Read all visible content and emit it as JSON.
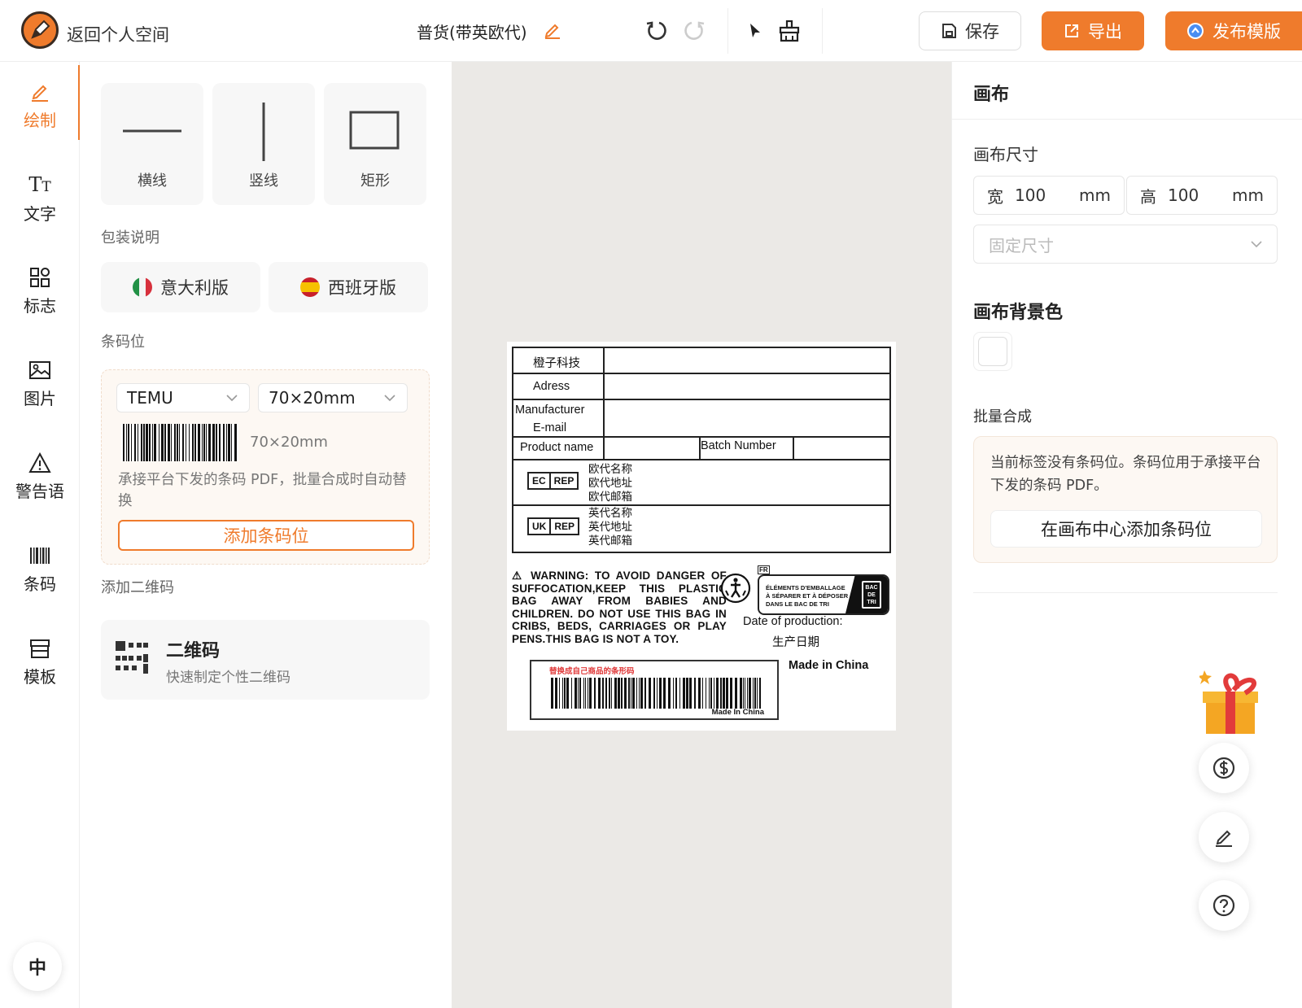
{
  "header": {
    "back_label": "返回个人空间",
    "doc_title": "普货(带英欧代)",
    "buttons": {
      "save": "保存",
      "export": "导出",
      "publish": "发布模版"
    }
  },
  "leftnav": {
    "items": [
      {
        "label": "绘制",
        "icon": "pencil-icon",
        "active": true
      },
      {
        "label": "文字",
        "icon": "text-icon"
      },
      {
        "label": "标志",
        "icon": "grid-icon"
      },
      {
        "label": "图片",
        "icon": "image-icon"
      },
      {
        "label": "警告语",
        "icon": "warning-icon"
      },
      {
        "label": "条码",
        "icon": "barcode-icon"
      },
      {
        "label": "模板",
        "icon": "store-icon"
      }
    ],
    "lang": "中"
  },
  "tools": {
    "shapes": [
      "横线",
      "竖线",
      "矩形"
    ],
    "packaging_label": "包装说明",
    "packaging": [
      "意大利版",
      "西班牙版"
    ],
    "barcode_label": "条码位",
    "barcode_platform": "TEMU",
    "barcode_size": "70×20mm",
    "barcode_preview_size": "70×20mm",
    "barcode_desc": "承接平台下发的条码 PDF，批量合成时自动替换",
    "barcode_add": "添加条码位",
    "qr_label": "添加二维码",
    "qr_title": "二维码",
    "qr_sub": "快速制定个性二维码"
  },
  "label": {
    "company": "橙子科技",
    "address": "Adress",
    "manufacturer": "Manufacturer",
    "email": "E-mail",
    "product_name": "Product  name",
    "batch_number": "Batch  Number",
    "ec_rep": [
      "EC",
      "REP"
    ],
    "eu_lines": [
      "欧代名称",
      "欧代地址",
      "欧代邮箱"
    ],
    "uk_rep": [
      "UK",
      "REP"
    ],
    "uk_lines": [
      "英代名称",
      "英代地址",
      "英代邮箱"
    ],
    "warning": "⚠ WARNING: TO AVOID DANGER OF SUFFOCATION,KEEP THIS PLASTIC BAG AWAY FROM BABIES AND CHILDREN. DO NOT USE THIS BAG IN CRIBS, BEDS, CARRIAGES OR PLAY PENS.THIS BAG IS NOT A TOY.",
    "fr_tag": "FR",
    "fr_lines": [
      "ÉLÉMENTS D'EMBALLAGE",
      "À SÉPARER ET À DÉPOSER",
      "DANS LE BAC DE TRI"
    ],
    "fr_bin": [
      "BAC",
      "DE",
      "TRI"
    ],
    "date_of_production": "Date  of  production:",
    "date_cn": "生产日期",
    "made_in_china": "Made  in  China",
    "barcode_hint": "替换成自己商品的条形码",
    "barcode_made": "Made In China"
  },
  "right": {
    "title": "画布",
    "size_label": "画布尺寸",
    "width_label": "宽",
    "width_value": "100",
    "height_label": "高",
    "height_value": "100",
    "unit": "mm",
    "fixed_placeholder": "固定尺寸",
    "bg_label": "画布背景色",
    "bg_color": "#ffffff",
    "batch_label": "批量合成",
    "batch_text": "当前标签没有条码位。条码位用于承接平台下发的条码 PDF。",
    "batch_btn": "在画布中心添加条码位"
  },
  "colors": {
    "accent": "#ef7b2c"
  }
}
